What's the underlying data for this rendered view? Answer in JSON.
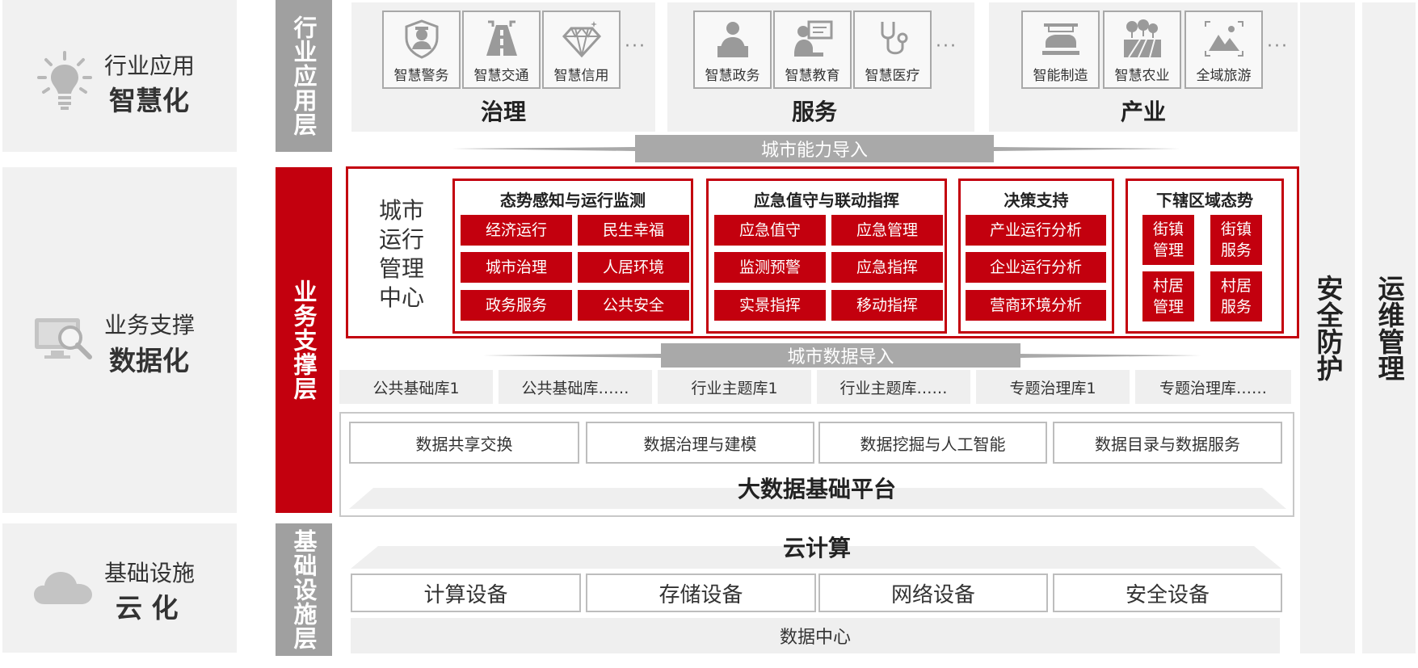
{
  "left_panels": [
    {
      "sub": "行业应用",
      "main": "智慧化",
      "icon": "lightbulb-icon"
    },
    {
      "sub": "业务支撑",
      "main": "数据化",
      "icon": "monitor-search-icon"
    },
    {
      "sub": "基础设施",
      "main": "云 化",
      "icon": "cloud-icon"
    }
  ],
  "layers": {
    "app": "行业应用层",
    "business": "业务支撑层",
    "infra": "基础设施层"
  },
  "sectors": [
    {
      "title": "治理",
      "apps": [
        {
          "label": "智慧警务",
          "icon": "police-icon"
        },
        {
          "label": "智慧交通",
          "icon": "road-icon"
        },
        {
          "label": "智慧信用",
          "icon": "diamond-icon"
        }
      ]
    },
    {
      "title": "服务",
      "apps": [
        {
          "label": "智慧政务",
          "icon": "official-icon"
        },
        {
          "label": "智慧教育",
          "icon": "teacher-icon"
        },
        {
          "label": "智慧医疗",
          "icon": "stethoscope-icon"
        }
      ]
    },
    {
      "title": "产业",
      "apps": [
        {
          "label": "智能制造",
          "icon": "factory-icon"
        },
        {
          "label": "智慧农业",
          "icon": "farm-icon"
        },
        {
          "label": "全域旅游",
          "icon": "mountain-icon"
        }
      ]
    }
  ],
  "more": "···",
  "arrows": {
    "capability": "城市能力导入",
    "data": "城市数据导入"
  },
  "center": {
    "name_lines": [
      "城市",
      "运行",
      "管理",
      "中心"
    ],
    "groups": [
      {
        "title": "态势感知与运行监测",
        "items": [
          "经济运行",
          "民生幸福",
          "城市治理",
          "人居环境",
          "政务服务",
          "公共安全"
        ]
      },
      {
        "title": "应急值守与联动指挥",
        "items": [
          "应急值守",
          "应急管理",
          "监测预警",
          "应急指挥",
          "实景指挥",
          "移动指挥"
        ]
      },
      {
        "title": "决策支持",
        "items": [
          "产业运行分析",
          "企业运行分析",
          "营商环境分析"
        ]
      },
      {
        "title": "下辖区域态势",
        "items": [
          "街镇\n管理",
          "街镇\n服务",
          "村居\n管理",
          "村居\n服务"
        ]
      }
    ]
  },
  "databases": [
    "公共基础库1",
    "公共基础库……",
    "行业主题库1",
    "行业主题库……",
    "专题治理库1",
    "专题治理库……"
  ],
  "bigdata": {
    "items": [
      "数据共享交换",
      "数据治理与建模",
      "数据挖掘与人工智能",
      "数据目录与数据服务"
    ],
    "title": "大数据基础平台"
  },
  "cloud": {
    "title": "云计算",
    "items": [
      "计算设备",
      "存储设备",
      "网络设备",
      "安全设备"
    ],
    "datacenter": "数据中心"
  },
  "right": {
    "security": "安全防护",
    "ops": "运维管理"
  }
}
